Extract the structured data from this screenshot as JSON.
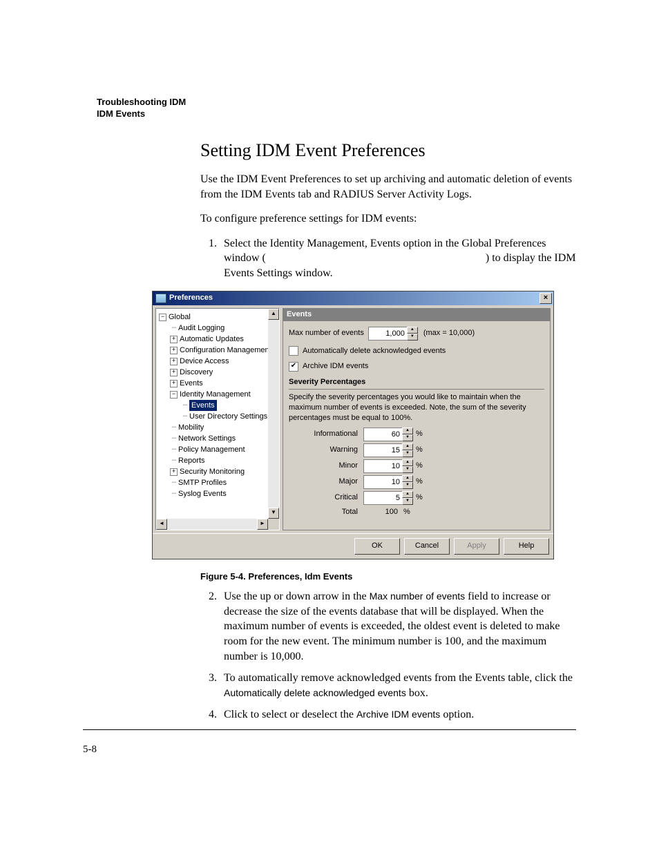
{
  "runningHead": {
    "line1": "Troubleshooting IDM",
    "line2": "IDM Events"
  },
  "sectionTitle": "Setting IDM Event Preferences",
  "intro1": "Use the IDM Event Preferences to set up archiving and automatic deletion of events from the IDM Events tab and RADIUS Server Activity Logs.",
  "intro2": "To configure preference settings for IDM events:",
  "step1a": "Select the Identity Management, Events option in the Global Preferences window (",
  "step1b": ") to display the IDM Events Settings window.",
  "figCaption": "Figure 5-4. Preferences, Idm Events",
  "step2a": "Use the up or down arrow in the ",
  "step2field": "Max number of events",
  "step2b": " field to increase or decrease the size of the events database that will be displayed. When the maximum number of events is exceeded, the oldest event is deleted to make room for the new event. The minimum number is 100, and the maximum number is 10,000.",
  "step3a": "To automatically remove acknowledged events from the Events table, click the ",
  "step3field": "Automatically delete acknowledged events",
  "step3b": " box.",
  "step4a": "Click to select or deselect the ",
  "step4field": "Archive IDM events",
  "step4b": " option.",
  "pageNum": "5-8",
  "win": {
    "title": "Preferences",
    "close": "×",
    "tree": {
      "global": "Global",
      "items": [
        "Audit Logging",
        "Automatic Updates",
        "Configuration Management",
        "Device Access",
        "Discovery",
        "Events",
        "Identity Management",
        "Events",
        "User Directory Settings",
        "Mobility",
        "Network Settings",
        "Policy Management",
        "Reports",
        "Security Monitoring",
        "SMTP Profiles",
        "Syslog Events"
      ]
    },
    "events": {
      "hdr": "Events",
      "maxLabel": "Max number of events",
      "maxValue": "1,000",
      "maxHint": "(max = 10,000)",
      "autoDel": "Automatically delete acknowledged events",
      "archive": "Archive IDM events",
      "sevTitle": "Severity Percentages",
      "sevHelp": "Specify the severity percentages you would like to maintain when the maximum number of events is exceeded. Note, the sum of the severity percentages must be equal to 100%.",
      "rows": [
        {
          "label": "Informational",
          "value": "60"
        },
        {
          "label": "Warning",
          "value": "15"
        },
        {
          "label": "Minor",
          "value": "10"
        },
        {
          "label": "Major",
          "value": "10"
        },
        {
          "label": "Critical",
          "value": "5"
        }
      ],
      "totalLabel": "Total",
      "totalValue": "100",
      "pct": "%"
    },
    "buttons": {
      "ok": "OK",
      "cancel": "Cancel",
      "apply": "Apply",
      "help": "Help"
    }
  }
}
